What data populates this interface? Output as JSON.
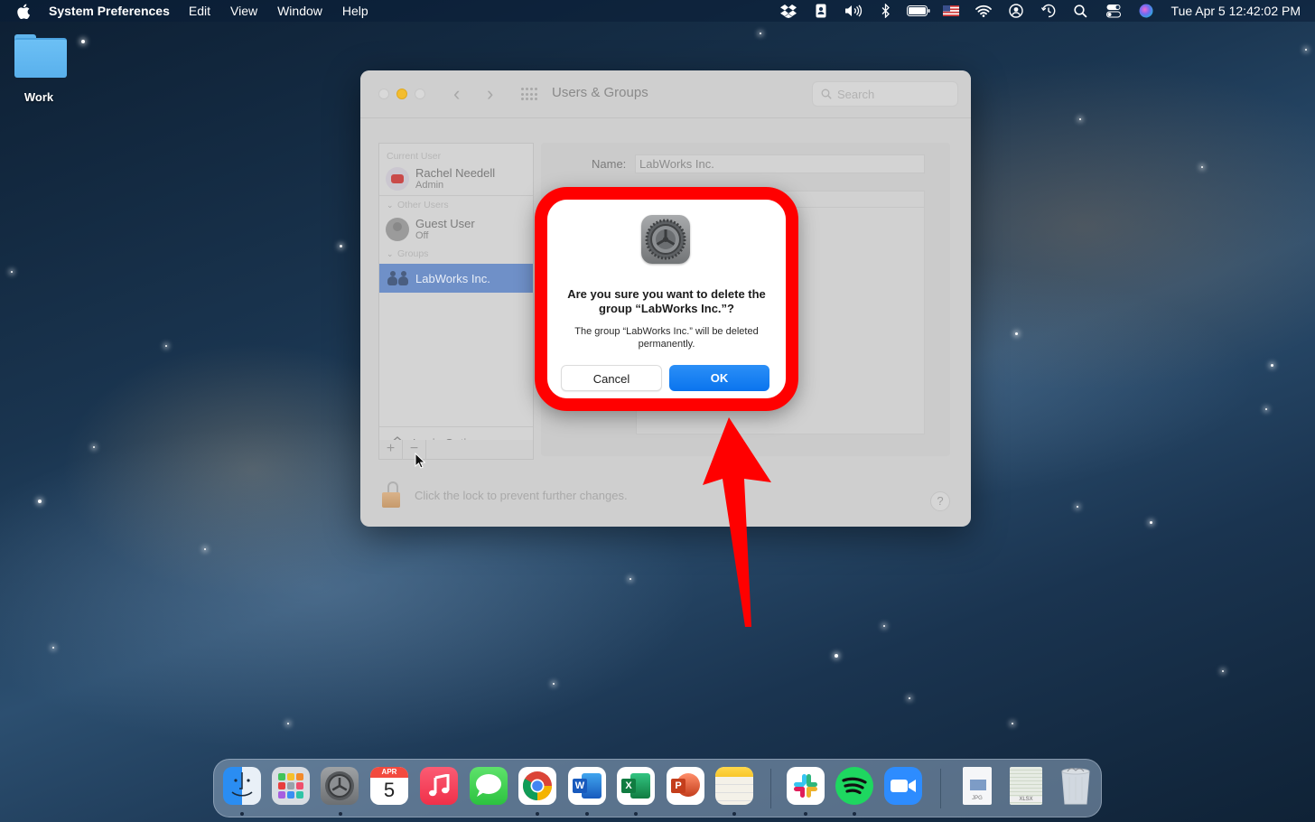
{
  "menubar": {
    "app_name": "System Preferences",
    "menus": [
      "Edit",
      "View",
      "Window",
      "Help"
    ],
    "status_icons": [
      "dropbox-icon",
      "contact-card-icon",
      "volume-icon",
      "bluetooth-icon",
      "battery-icon",
      "us-flag-input-icon",
      "wifi-icon",
      "user-account-icon",
      "time-machine-icon",
      "spotlight-search-icon",
      "control-center-icon",
      "siri-icon"
    ],
    "clock": "Tue Apr 5  12:42:02 PM"
  },
  "desktop": {
    "folder_label": "Work"
  },
  "window": {
    "title": "Users & Groups",
    "search_placeholder": "Search",
    "sidebar": {
      "current_user_header": "Current User",
      "current_user": {
        "name": "Rachel Needell",
        "role": "Admin"
      },
      "other_users_header": "Other Users",
      "other_users": [
        {
          "name": "Guest User",
          "status": "Off"
        }
      ],
      "groups_header": "Groups",
      "groups": [
        {
          "name": "LabWorks Inc.",
          "selected": true
        }
      ],
      "login_options": "Login Options",
      "add_label": "+",
      "remove_label": "−"
    },
    "detail": {
      "name_label": "Name:",
      "name_value": "LabWorks Inc."
    },
    "lock_text": "Click the lock to prevent further changes.",
    "help_label": "?"
  },
  "dialog": {
    "title": "Are you sure you want to delete the group “LabWorks Inc.”?",
    "message": "The group “LabWorks Inc.” will be deleted permanently.",
    "cancel_label": "Cancel",
    "ok_label": "OK"
  },
  "annotation": {
    "highlight_color": "#ff0000",
    "arrow_color": "#ff0000"
  },
  "dock": {
    "apps": [
      {
        "name": "Finder",
        "running": true
      },
      {
        "name": "Launchpad",
        "running": false
      },
      {
        "name": "System Preferences",
        "running": true
      },
      {
        "name": "Calendar",
        "running": false,
        "month": "APR",
        "day": "5"
      },
      {
        "name": "Music",
        "running": false
      },
      {
        "name": "Messages",
        "running": false
      },
      {
        "name": "Google Chrome",
        "running": true
      },
      {
        "name": "Microsoft Word",
        "running": true,
        "letter": "W"
      },
      {
        "name": "Microsoft Excel",
        "running": true,
        "letter": "X"
      },
      {
        "name": "Microsoft PowerPoint",
        "running": false,
        "letter": "P"
      },
      {
        "name": "Notes",
        "running": true
      },
      {
        "name": "Slack",
        "running": true
      },
      {
        "name": "Spotify",
        "running": true
      },
      {
        "name": "Zoom",
        "running": false
      }
    ],
    "documents": [
      {
        "name": "JPG document",
        "label": "JPG"
      },
      {
        "name": "XLSX document",
        "label": "XLSX"
      }
    ],
    "trash": "Trash"
  },
  "colors": {
    "accent_blue": "#0a74ee",
    "selection_blue": "#6f90c8",
    "minimize_yellow": "#f3bd2f"
  }
}
